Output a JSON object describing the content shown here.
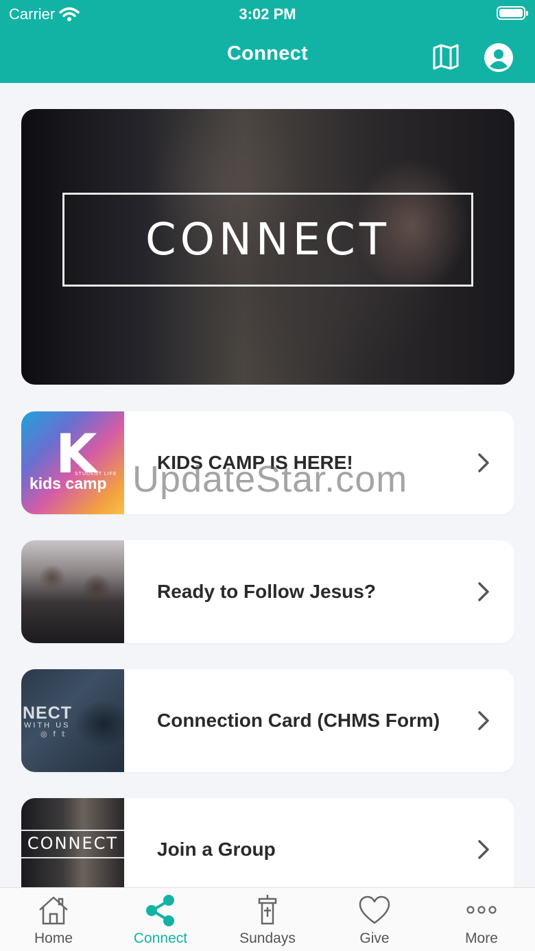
{
  "status_bar": {
    "carrier": "Carrier",
    "time": "3:02 PM"
  },
  "nav": {
    "title": "Connect",
    "icons": [
      "map-icon",
      "profile-icon"
    ]
  },
  "hero": {
    "title": "CONNECT"
  },
  "items": [
    {
      "title": "KIDS CAMP IS HERE!",
      "thumb_text": "kids camp",
      "thumb_k": "K",
      "thumb_small": "STUDENT LIFE"
    },
    {
      "title": "Ready to Follow Jesus?"
    },
    {
      "title": "Connection Card (CHMS Form)",
      "thumb_big": "NECT",
      "thumb_small": "WITH US",
      "thumb_social": "◎ f 𝕥"
    },
    {
      "title": "Join a Group",
      "thumb_text": "CONNECT"
    }
  ],
  "watermark": "UpdateStar.com",
  "tabs": [
    {
      "label": "Home",
      "icon": "home-icon"
    },
    {
      "label": "Connect",
      "icon": "share-icon",
      "active": true
    },
    {
      "label": "Sundays",
      "icon": "pulpit-icon"
    },
    {
      "label": "Give",
      "icon": "heart-icon"
    },
    {
      "label": "More",
      "icon": "more-icon"
    }
  ],
  "colors": {
    "accent": "#12b3a4",
    "background": "#f3f5f8"
  }
}
